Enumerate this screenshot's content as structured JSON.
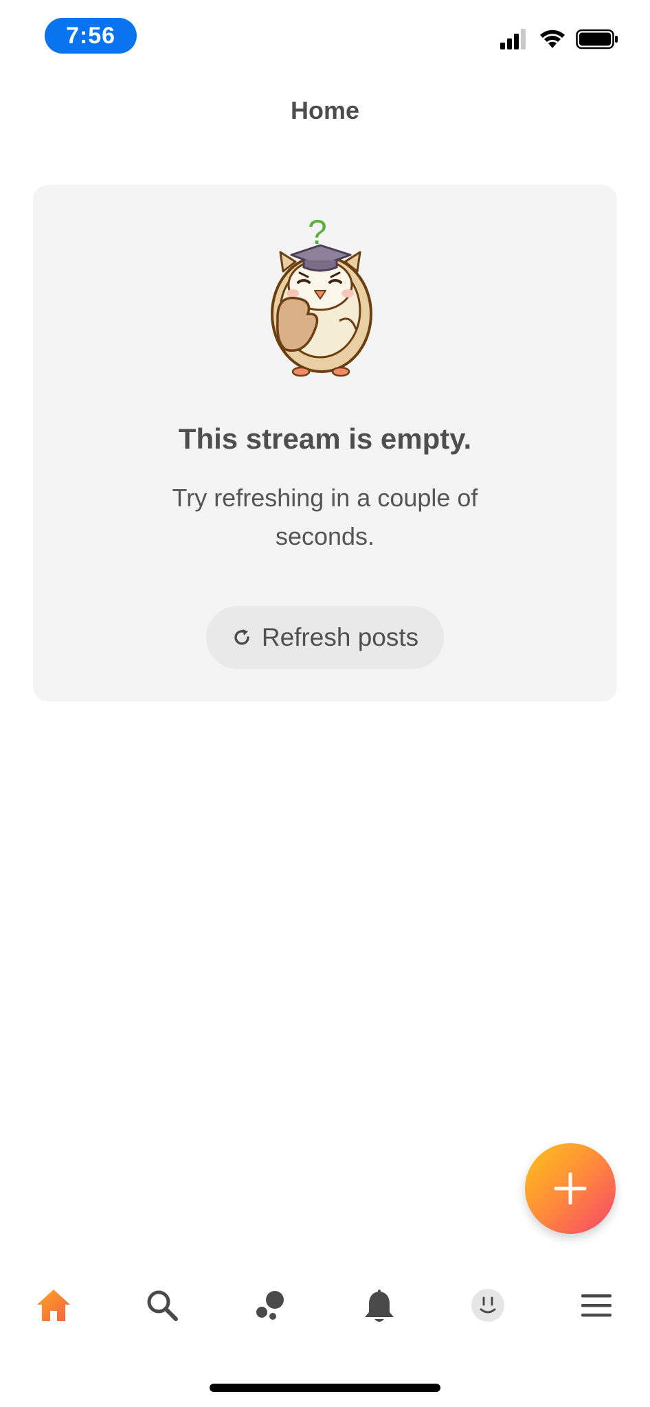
{
  "status_bar": {
    "time": "7:56",
    "icons": [
      "cellular-signal-icon",
      "wifi-icon",
      "battery-icon"
    ]
  },
  "header": {
    "title": "Home",
    "filter_icon": "sliders-icon"
  },
  "empty_state": {
    "illustration": "confused-owl-illustration",
    "title": "This stream is empty.",
    "message": "Try refreshing in a couple of seconds.",
    "refresh_button": {
      "icon": "refresh-icon",
      "label": "Refresh posts"
    }
  },
  "fab": {
    "icon": "plus-icon"
  },
  "bottom_nav": {
    "items": [
      {
        "name": "home",
        "icon": "home-icon",
        "active": true
      },
      {
        "name": "search",
        "icon": "search-icon",
        "active": false
      },
      {
        "name": "groups",
        "icon": "bubbles-icon",
        "active": false
      },
      {
        "name": "notifications",
        "icon": "bell-icon",
        "active": false
      },
      {
        "name": "profile",
        "icon": "avatar-icon",
        "active": false
      },
      {
        "name": "menu",
        "icon": "hamburger-icon",
        "active": false
      }
    ]
  },
  "colors": {
    "accent": "#f78c2e",
    "time_pill": "#0a73f0",
    "card_bg": "#f4f4f4",
    "fab_gradient": [
      "#fcc419",
      "#f4436c"
    ]
  }
}
